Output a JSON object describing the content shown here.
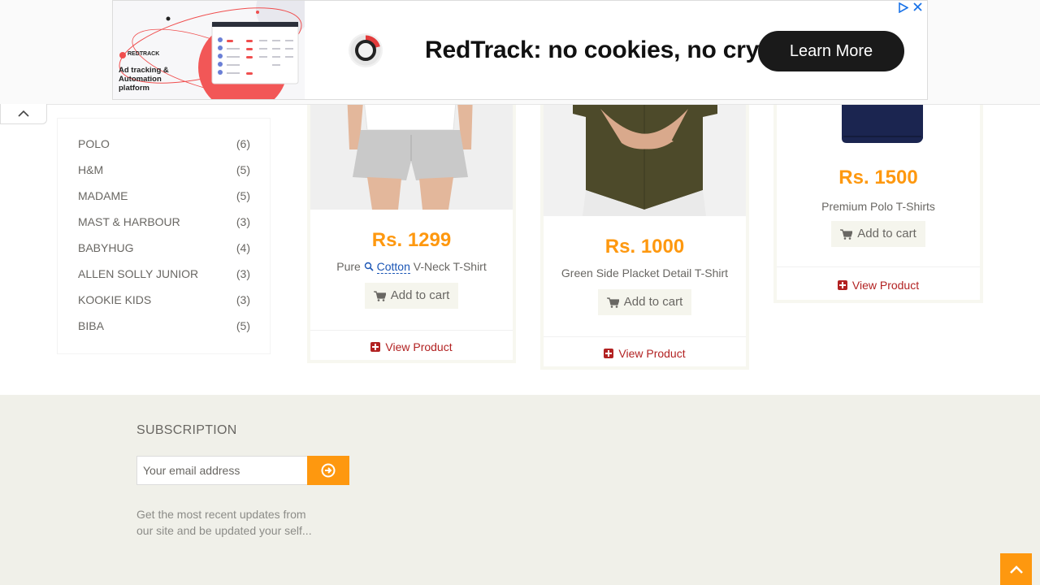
{
  "ad": {
    "logo_text": "REDTRACK",
    "tagline": "Ad tracking & Automation platform",
    "headline": "RedTrack: no cookies, no cry",
    "cta": "Learn More"
  },
  "brands": [
    {
      "name": "POLO",
      "count": "(6)"
    },
    {
      "name": "H&M",
      "count": "(5)"
    },
    {
      "name": "MADAME",
      "count": "(5)"
    },
    {
      "name": "MAST & HARBOUR",
      "count": "(3)"
    },
    {
      "name": "BABYHUG",
      "count": "(4)"
    },
    {
      "name": "ALLEN SOLLY JUNIOR",
      "count": "(3)"
    },
    {
      "name": "KOOKIE KIDS",
      "count": "(3)"
    },
    {
      "name": "BIBA",
      "count": "(5)"
    }
  ],
  "products": [
    {
      "price": "Rs. 1299",
      "title_before": "Pure",
      "title_link": "Cotton",
      "title_after": "V-Neck T-Shirt",
      "cart_label": "Add to cart",
      "view_label": "View Product"
    },
    {
      "price": "Rs. 1000",
      "title": "Green Side Placket Detail T-Shirt",
      "cart_label": "Add to cart",
      "view_label": "View Product"
    },
    {
      "price": "Rs. 1500",
      "title": "Premium Polo T-Shirts",
      "cart_label": "Add to cart",
      "view_label": "View Product"
    }
  ],
  "footer": {
    "subscription_title": "SUBSCRIPTION",
    "email_placeholder": "Your email address",
    "description": "Get the most recent updates from our site and be updated your self..."
  },
  "colors": {
    "accent": "#fe980f",
    "link_red": "#b22222",
    "footer_bg": "#f0f0e9"
  },
  "icons": [
    "chevron-up-icon",
    "cart-icon",
    "plus-square-icon",
    "arrow-circle-right-icon",
    "adchoices-icon",
    "close-icon",
    "search-icon"
  ]
}
